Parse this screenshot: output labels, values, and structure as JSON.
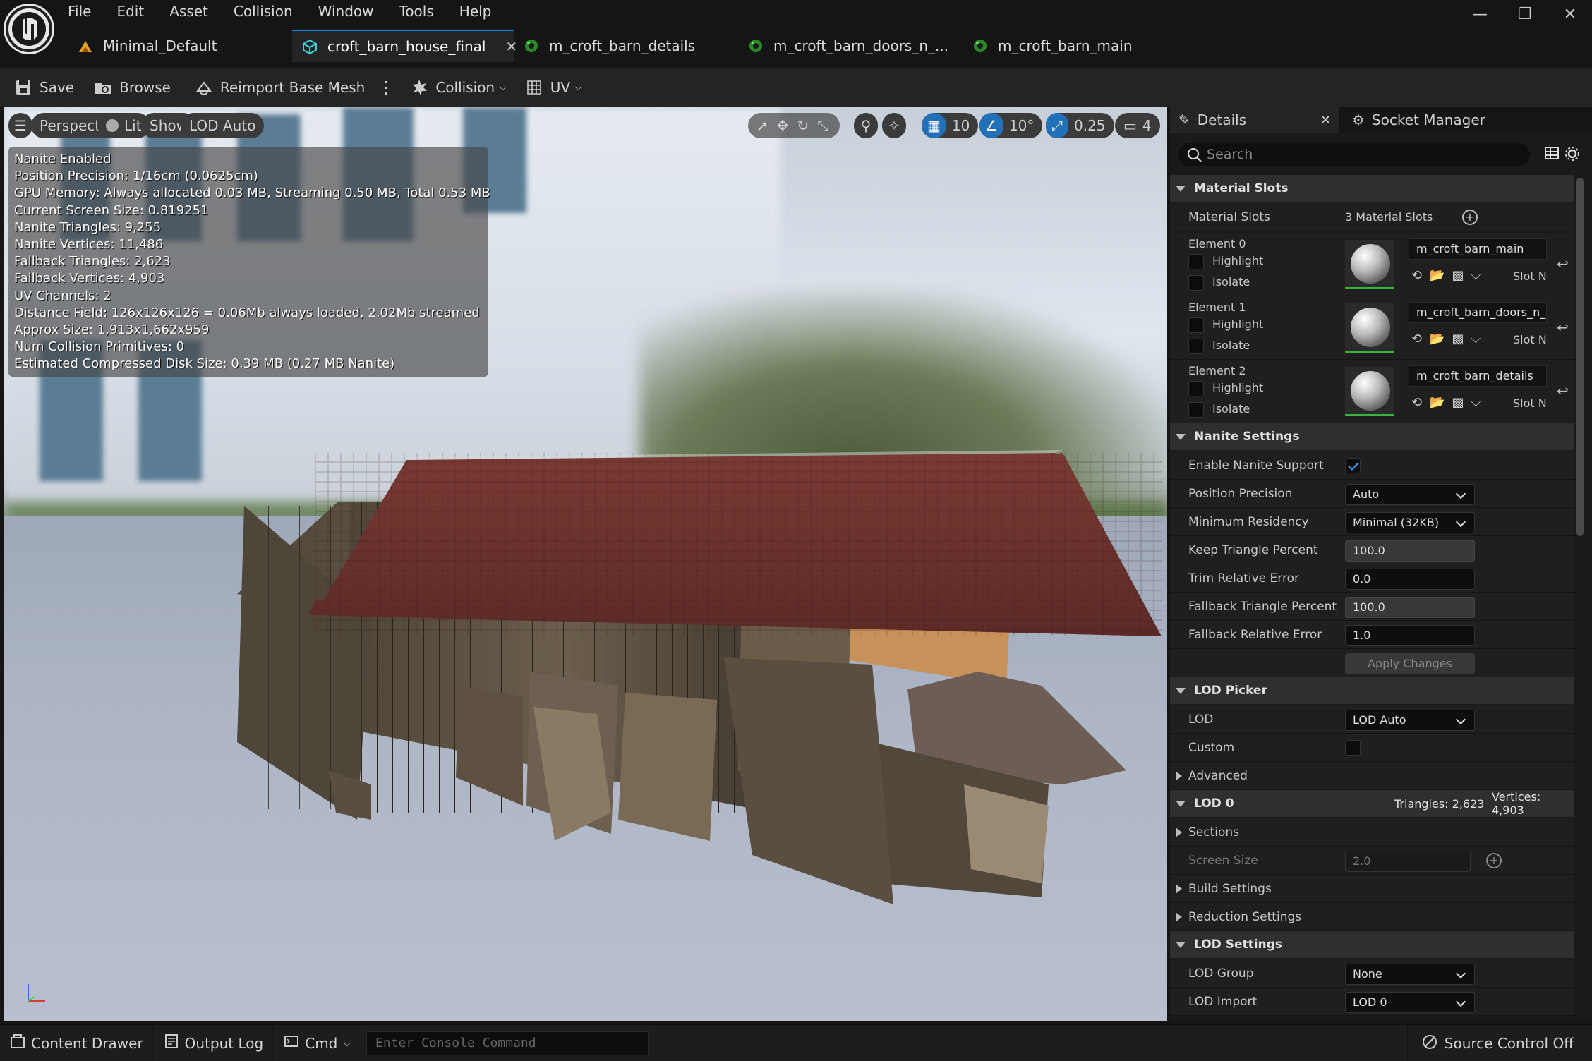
{
  "menu": [
    "File",
    "Edit",
    "Asset",
    "Collision",
    "Window",
    "Tools",
    "Help"
  ],
  "tabs": [
    {
      "label": "Minimal_Default",
      "icon": "level-icon"
    },
    {
      "label": "croft_barn_house_final",
      "icon": "static-mesh-icon",
      "active": true
    },
    {
      "label": "m_croft_barn_details",
      "icon": "material-icon"
    },
    {
      "label": "m_croft_barn_doors_n_...",
      "icon": "material-icon"
    },
    {
      "label": "m_croft_barn_main",
      "icon": "material-icon"
    }
  ],
  "toolbar": {
    "save": "Save",
    "browse": "Browse",
    "reimport": "Reimport Base Mesh",
    "collision": "Collision",
    "uv": "UV"
  },
  "viewport": {
    "perspective": "Perspective",
    "lit": "Lit",
    "show": "Show",
    "lod": "LOD Auto",
    "grid_snap": "10",
    "rot_snap": "10°",
    "scale_snap": "0.25",
    "cam_speed": "4",
    "stats": [
      "Nanite Enabled",
      "Position Precision: 1/16cm (0.0625cm)",
      "GPU Memory: Always allocated 0.03 MB, Streaming 0.50 MB, Total 0.53 MB",
      "Current Screen Size:  0.819251",
      "Nanite Triangles:  9,255",
      "Nanite Vertices:  11,486",
      "Fallback Triangles:  2,623",
      "Fallback Vertices:  4,903",
      "UV Channels:  2",
      "Distance Field:  126x126x126 = 0.06Mb always loaded, 2.02Mb streamed",
      "Approx Size: 1,913x1,662x959",
      "Num Collision Primitives:  0",
      "Estimated Compressed Disk Size: 0.39 MB (0.27 MB Nanite)"
    ]
  },
  "details": {
    "tab_details": "Details",
    "tab_socket": "Socket Manager",
    "search_placeholder": "Search",
    "material_slots": {
      "header": "Material Slots",
      "label": "Material Slots",
      "count": "3 Material Slots",
      "highlight": "Highlight",
      "isolate": "Isolate",
      "slot_n": "Slot N",
      "elements": [
        {
          "name": "Element 0",
          "material": "m_croft_barn_main"
        },
        {
          "name": "Element 1",
          "material": "m_croft_barn_doors_n_win"
        },
        {
          "name": "Element 2",
          "material": "m_croft_barn_details"
        }
      ]
    },
    "nanite": {
      "header": "Nanite Settings",
      "enable_label": "Enable Nanite Support",
      "position_precision_label": "Position Precision",
      "position_precision": "Auto",
      "min_residency_label": "Minimum Residency",
      "min_residency": "Minimal (32KB)",
      "keep_tri_label": "Keep Triangle Percent",
      "keep_tri": "100.0",
      "trim_err_label": "Trim Relative Error",
      "trim_err": "0.0",
      "fallback_tri_label": "Fallback Triangle Percent",
      "fallback_tri": "100.0",
      "fallback_err_label": "Fallback Relative Error",
      "fallback_err": "1.0",
      "apply": "Apply Changes"
    },
    "lod_picker": {
      "header": "LOD Picker",
      "lod_label": "LOD",
      "lod": "LOD Auto",
      "custom_label": "Custom",
      "advanced": "Advanced"
    },
    "lod0": {
      "header": "LOD 0",
      "triangles": "Triangles: 2,623",
      "vertices": "Vertices: 4,903",
      "sections": "Sections",
      "screen_size_label": "Screen Size",
      "screen_size": "2.0",
      "build": "Build Settings",
      "reduction": "Reduction Settings"
    },
    "lod_settings": {
      "header": "LOD Settings",
      "group_label": "LOD Group",
      "group": "None",
      "import_label": "LOD Import",
      "import": "LOD 0"
    }
  },
  "statusbar": {
    "content_drawer": "Content Drawer",
    "output_log": "Output Log",
    "cmd": "Cmd",
    "console_placeholder": "Enter Console Command",
    "source_control": "Source Control Off"
  }
}
